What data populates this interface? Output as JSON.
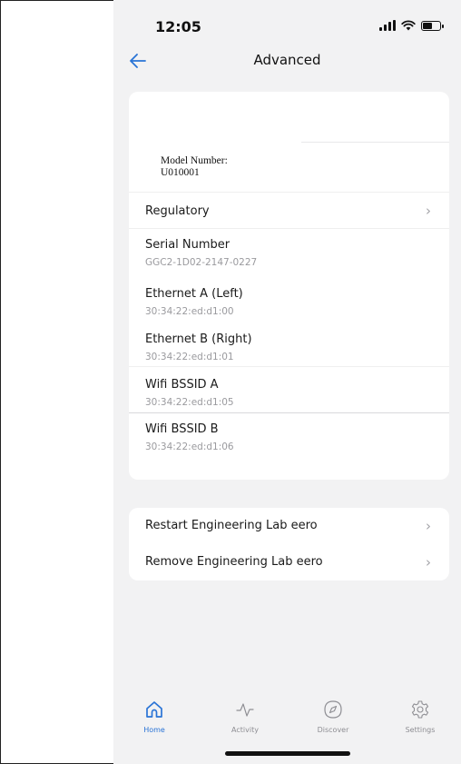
{
  "status_bar": {
    "time": "12:05",
    "battery_level": 0.55
  },
  "header": {
    "title": "Advanced",
    "back_icon": "arrow-left-icon"
  },
  "info": {
    "model_label": "Model Number:",
    "model_value": "U010001",
    "regulatory_label": "Regulatory",
    "serial_label": "Serial Number",
    "serial_value": "GGC2-1D02-2147-0227",
    "ethernet_a_label": "Ethernet A (Left)",
    "ethernet_a_value": "30:34:22:ed:d1:00",
    "ethernet_b_label": "Ethernet B (Right)",
    "ethernet_b_value": "30:34:22:ed:d1:01",
    "bssid_a_label": "Wifi BSSID A",
    "bssid_a_value": "30:34:22:ed:d1:05",
    "bssid_b_label": "Wifi BSSID B",
    "bssid_b_value": "30:34:22:ed:d1:06"
  },
  "actions": {
    "restart_label": "Restart Engineering Lab eero",
    "remove_label": "Remove Engineering Lab eero"
  },
  "tabs": [
    {
      "label": "Home",
      "icon": "home-icon",
      "active": true
    },
    {
      "label": "Activity",
      "icon": "activity-icon",
      "active": false
    },
    {
      "label": "Discover",
      "icon": "compass-icon",
      "active": false
    },
    {
      "label": "Settings",
      "icon": "gear-icon",
      "active": false
    }
  ],
  "colors": {
    "accent": "#2a74d6",
    "background": "#f2f2f3",
    "secondary_text": "#9a9a9e"
  }
}
